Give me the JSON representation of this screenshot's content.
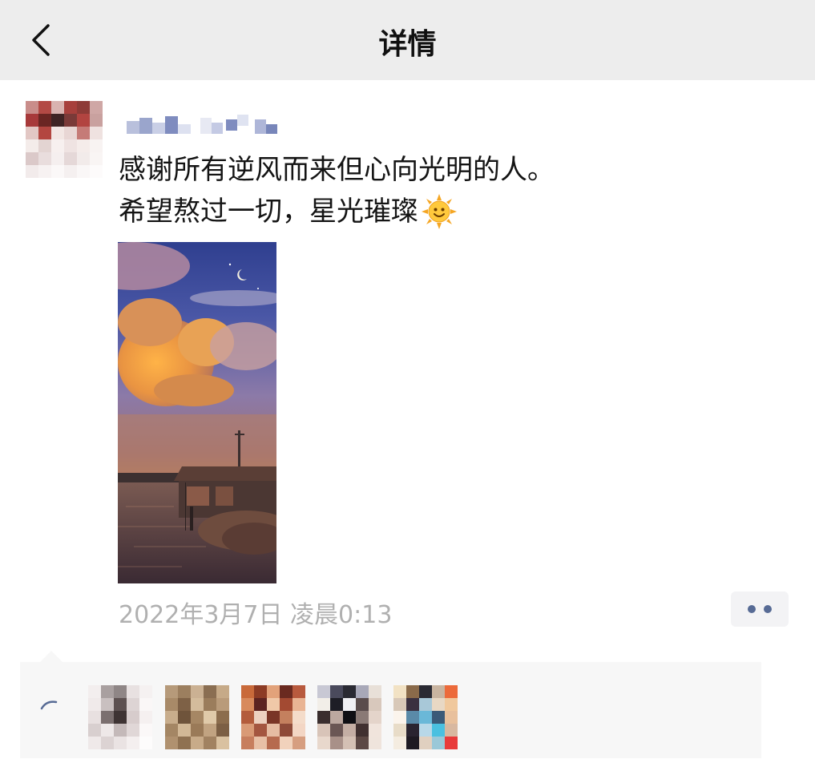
{
  "nav": {
    "title": "详情",
    "back_icon": "chevron-left-icon"
  },
  "post": {
    "lines": [
      "感谢所有逆风而来但心向光明的人。",
      "希望熬过一切，星光璀璨"
    ],
    "emoji": "sun-with-face-icon",
    "timestamp": "2022年3月7日 凌晨0:13",
    "more_icon": "two-dots-icon"
  },
  "likes": {
    "icon": "heart-outline-icon",
    "count_avatars": 5
  },
  "colors": {
    "nav_bg": "#ededed",
    "link_blue": "#576b95",
    "timestamp": "#b0b0b0",
    "likes_bg": "#f7f7f7"
  }
}
